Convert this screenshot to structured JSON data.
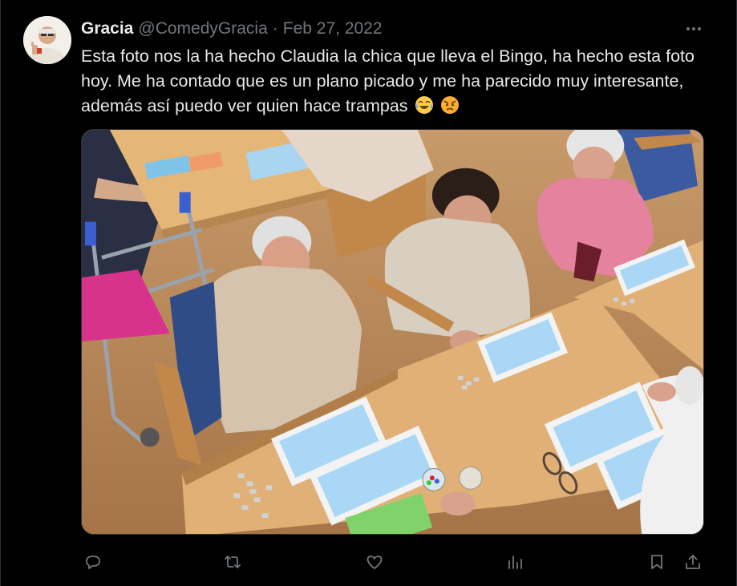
{
  "tweet": {
    "display_name": "Gracia",
    "handle": "@ComedyGracia",
    "separator": "·",
    "date": "Feb 27, 2022",
    "text": "Esta foto nos la ha hecho Claudia la chica que lleva el Bingo, ha hecho esta foto hoy. Me ha contado que es un plano picado y me ha parecido muy interesante, además así puedo ver quien hace trampas",
    "emojis": [
      "tears-of-joy-emoji",
      "angry-face-emoji"
    ]
  },
  "actions": [
    "reply-icon",
    "retweet-icon",
    "like-icon",
    "views-icon",
    "bookmark-icon",
    "share-icon"
  ],
  "colors": {
    "background": "#000000",
    "primary_text": "#e7e9ea",
    "secondary_text": "#71767b",
    "border": "#2f3336"
  }
}
